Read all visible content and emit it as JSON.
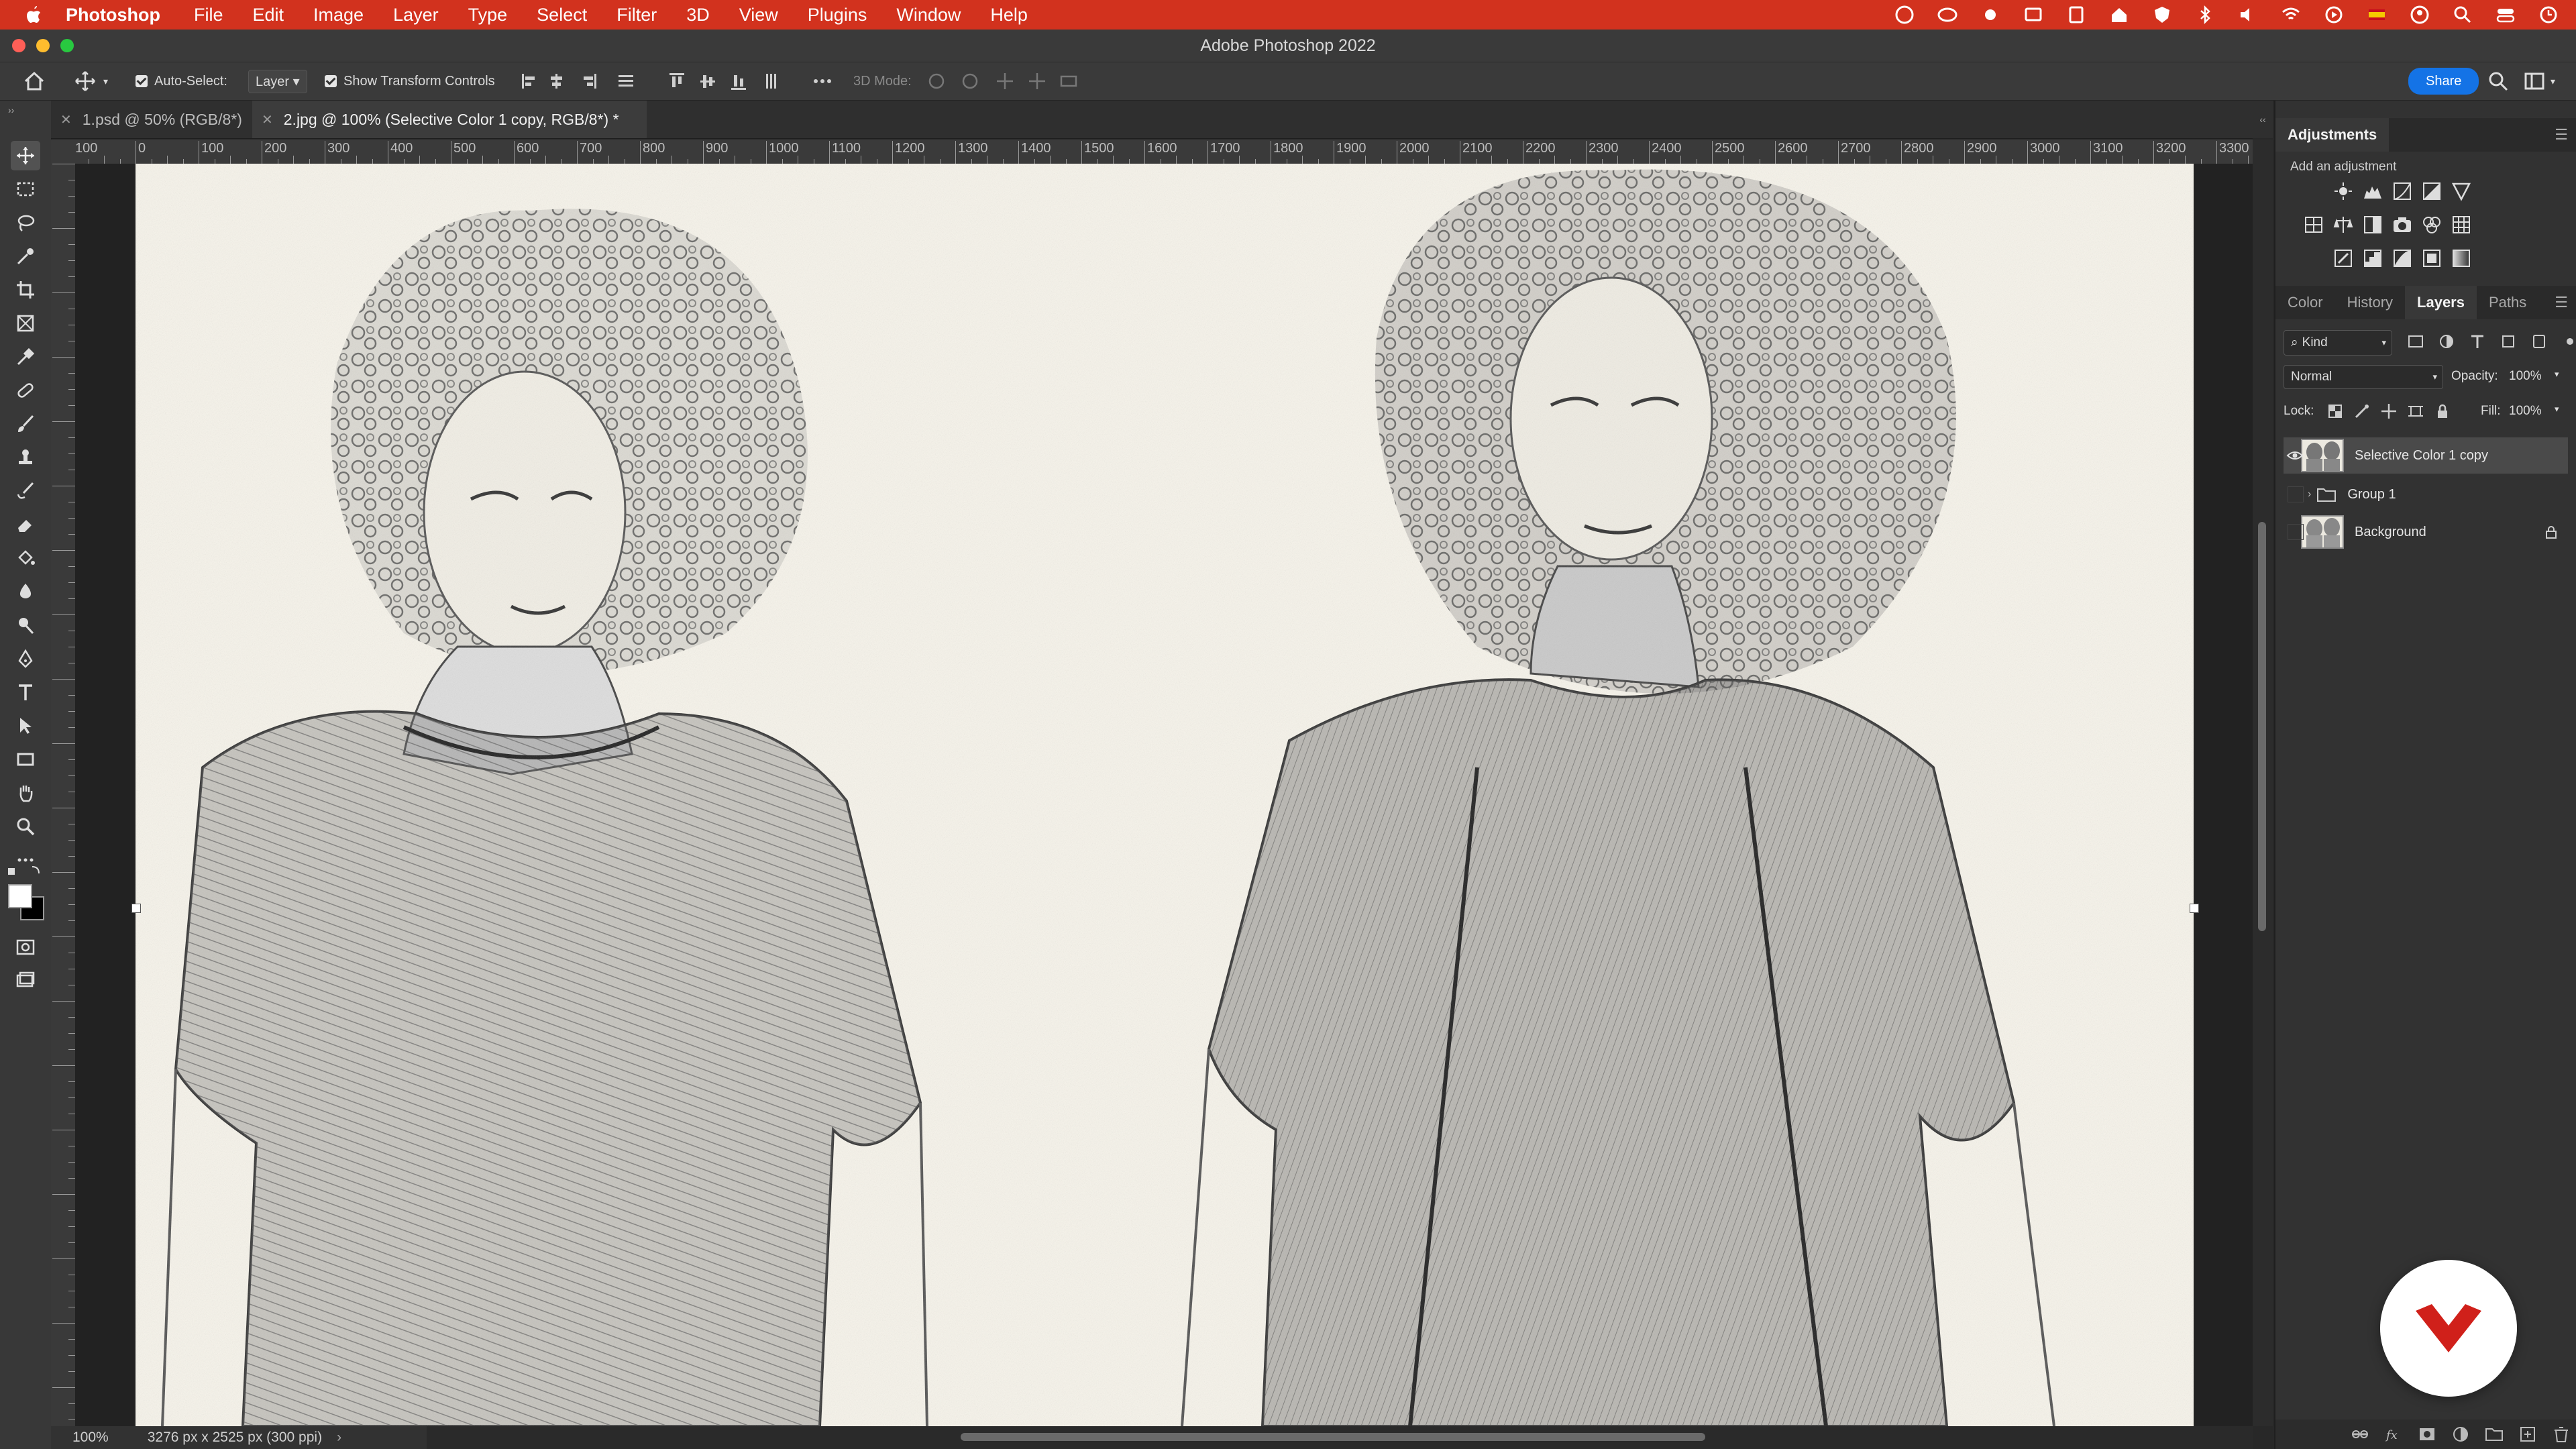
{
  "menubar": {
    "app_name": "Photoshop",
    "items": [
      "File",
      "Edit",
      "Image",
      "Layer",
      "Type",
      "Select",
      "Filter",
      "3D",
      "View",
      "Plugins",
      "Window",
      "Help"
    ]
  },
  "window": {
    "title": "Adobe Photoshop 2022"
  },
  "options_bar": {
    "auto_select_label": "Auto-Select:",
    "auto_select_value": "Layer",
    "transform_controls_label": "Show Transform Controls",
    "mode_3d_label": "3D Mode:",
    "share_label": "Share"
  },
  "document_tabs": [
    {
      "label": "1.psd @ 50% (RGB/8*)",
      "active": false
    },
    {
      "label": "2.jpg @ 100% (Selective Color 1 copy, RGB/8*) *",
      "active": true
    }
  ],
  "ruler": {
    "h_labels": [
      "100",
      "0",
      "100",
      "200",
      "300",
      "400",
      "500",
      "600",
      "700",
      "800",
      "900",
      "1000",
      "1100",
      "1200",
      "1300",
      "1400",
      "1500",
      "1600",
      "1700",
      "1800",
      "1900",
      "2000",
      "2100",
      "2200",
      "2300",
      "2400",
      "2500",
      "2600",
      "2700",
      "2800",
      "2900",
      "3000",
      "3100",
      "3200",
      "3300"
    ]
  },
  "status_bar": {
    "zoom": "100%",
    "doc_info": "3276 px x 2525 px (300 ppi)"
  },
  "adjustments_panel": {
    "title": "Adjustments",
    "subtitle": "Add an adjustment"
  },
  "layers_panel": {
    "tabs": [
      "Color",
      "History",
      "Layers",
      "Paths"
    ],
    "active_tab": "Layers",
    "filter_kind": "Kind",
    "blend_mode": "Normal",
    "opacity_label": "Opacity:",
    "opacity_value": "100%",
    "lock_label": "Lock:",
    "fill_label": "Fill:",
    "fill_value": "100%",
    "layers": [
      {
        "name": "Selective Color 1 copy",
        "visible": true,
        "selected": true,
        "type": "pixel"
      },
      {
        "name": "Group 1",
        "visible": false,
        "selected": false,
        "type": "group"
      },
      {
        "name": "Background",
        "visible": false,
        "selected": false,
        "type": "pixel",
        "locked": true
      }
    ]
  },
  "colors": {
    "menubar_red": "#d2321e",
    "accent_blue": "#1473e6",
    "logo_red": "#d0201a"
  }
}
